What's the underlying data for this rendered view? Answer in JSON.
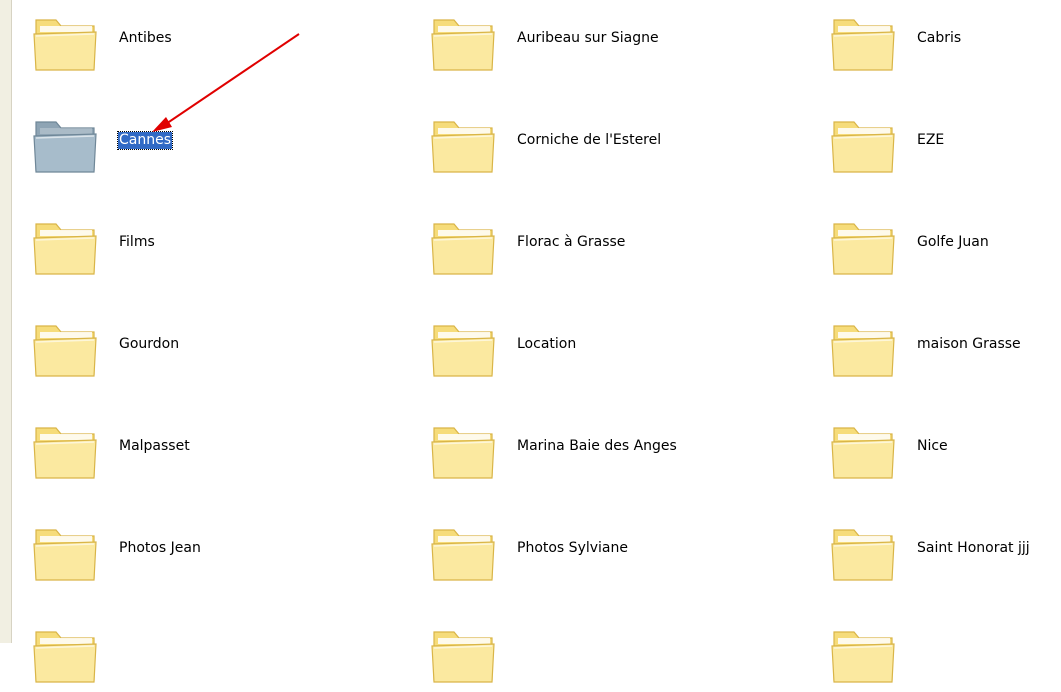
{
  "colors": {
    "folder_body": "#f6dc7a",
    "folder_front": "#fbe9a0",
    "folder_outline": "#d9b548",
    "folder_selected": "#8ea4b4",
    "selection_bg": "#316ac5",
    "arrow": "#e00000"
  },
  "folders": [
    {
      "label": "Antibes",
      "selected": false
    },
    {
      "label": "Auribeau sur Siagne",
      "selected": false
    },
    {
      "label": "Cabris",
      "selected": false
    },
    {
      "label": "Cannes",
      "selected": true
    },
    {
      "label": "Corniche de l'Esterel",
      "selected": false
    },
    {
      "label": "EZE",
      "selected": false
    },
    {
      "label": "Films",
      "selected": false
    },
    {
      "label": "Florac  à Grasse",
      "selected": false
    },
    {
      "label": "Golfe Juan",
      "selected": false
    },
    {
      "label": "Gourdon",
      "selected": false
    },
    {
      "label": "Location",
      "selected": false
    },
    {
      "label": "maison Grasse",
      "selected": false
    },
    {
      "label": "Malpasset",
      "selected": false
    },
    {
      "label": "Marina Baie des Anges",
      "selected": false
    },
    {
      "label": "Nice",
      "selected": false
    },
    {
      "label": "Photos Jean",
      "selected": false
    },
    {
      "label": "Photos Sylviane",
      "selected": false
    },
    {
      "label": "Saint Honorat jjj",
      "selected": false
    },
    {
      "label": "",
      "selected": false
    },
    {
      "label": "",
      "selected": false
    },
    {
      "label": "",
      "selected": false
    }
  ],
  "icon": "folder-icon",
  "annotation": "red-arrow"
}
